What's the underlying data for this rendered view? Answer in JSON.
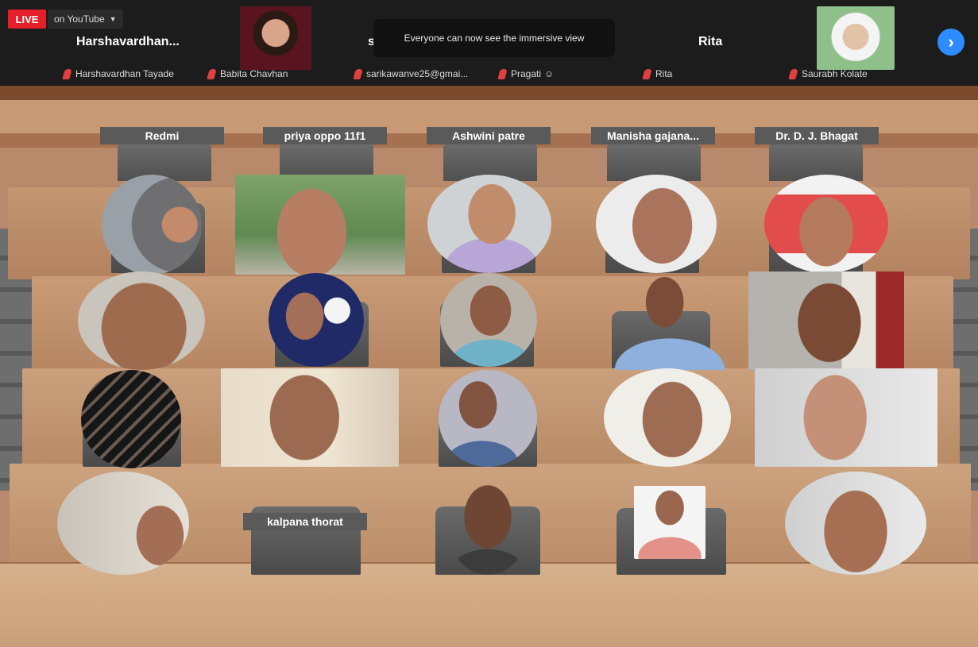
{
  "top_strip": {
    "live_badge": "LIVE",
    "stream_target": "on YouTube",
    "toast": "Everyone can now see the immersive view",
    "tiles": [
      {
        "name": "Harshavardhan...",
        "label": "Harshavardhan Tayade"
      },
      {
        "name": "",
        "label": "Babita Chavhan"
      },
      {
        "name": "s",
        "label": "sarikawanve25@gmai..."
      },
      {
        "name": "",
        "label": "Pragati"
      },
      {
        "name": "Rita",
        "label": "Rita"
      },
      {
        "name": "",
        "label": "Saurabh Kolate"
      }
    ],
    "pragati_emoji": "☺",
    "next_icon": "chevron-right-icon"
  },
  "immersive_view": {
    "name_plates": [
      "Redmi",
      "priya oppo 11f1",
      "Ashwini patre",
      "Manisha  gajana...",
      "Dr. D. J. Bhagat"
    ],
    "bottom_plate": "kalpana thorat"
  },
  "colors": {
    "live": "#e5202a",
    "mic_muted": "#e04040",
    "next_button": "#2d8cff",
    "toast_bg": "#111111",
    "plate_bg": "#5a5a5a"
  }
}
